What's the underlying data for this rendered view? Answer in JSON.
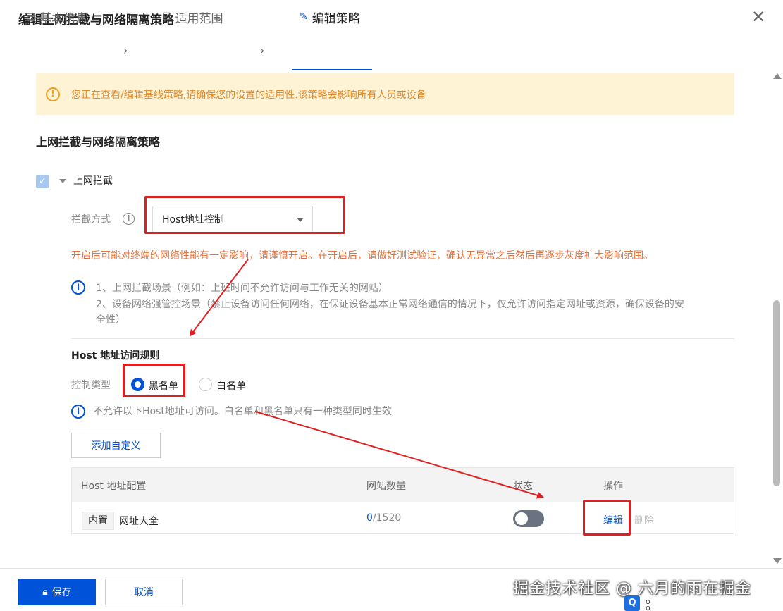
{
  "dialog": {
    "title": "编辑上网拦截与网络隔离策略",
    "close_label": "✕"
  },
  "tabs": [
    {
      "label": "基本信息",
      "icon": "list-icon",
      "active": false
    },
    {
      "label": "适用范围",
      "icon": "checklist-icon",
      "active": false
    },
    {
      "label": "编辑策略",
      "icon": "pencil-icon",
      "active": true
    }
  ],
  "tab_separator": "›",
  "warning": {
    "icon": "!",
    "text": "您正在查看/编辑基线策略,请确保您的设置的适用性.该策略会影响所有人员或设备"
  },
  "section": {
    "title": "上网拦截与网络隔离策略",
    "checkbox_label": "上网拦截",
    "checkbox_checked": true,
    "intercept_label": "拦截方式",
    "intercept_value": "Host地址控制",
    "orange_note": "开启后可能对终端的网络性能有一定影响，请谨慎开启。在开启后，请做好测试验证，确认无异常之后然后再逐步灰度扩大影响范围。",
    "tips": [
      "1、上网拦截场景（例如：上班时间不允许访问与工作无关的网站）",
      "2、设备网络强管控场景（禁止设备访问任何网络，在保证设备基本正常网络通信的情况下，仅允许访问指定网址或资源，确保设备的安",
      "全性）"
    ]
  },
  "rules": {
    "title": "Host 地址访问规则",
    "control_type_label": "控制类型",
    "options": [
      {
        "label": "黑名单",
        "selected": true
      },
      {
        "label": "白名单",
        "selected": false
      }
    ],
    "info_text": "不允许以下Host地址可访问。白名单和黑名单只有一种类型同时生效",
    "add_button": "添加自定义"
  },
  "table": {
    "columns": [
      "Host 地址配置",
      "网站数量",
      "状态",
      "操作"
    ],
    "rows": [
      {
        "tag": "内置",
        "name": "网址大全",
        "count_enabled": "0",
        "count_total": "/1520",
        "status_on": false,
        "edit": "编辑",
        "delete": "删除"
      }
    ]
  },
  "footer": {
    "save": "保存",
    "cancel": "取消",
    "watermark": "掘金技术社区 @ 六月的雨在掘金"
  },
  "colors": {
    "primary": "#0052d9",
    "warning_bg": "#fff3d6",
    "warning_text": "#e0892a",
    "annotation_red": "#e02020"
  }
}
